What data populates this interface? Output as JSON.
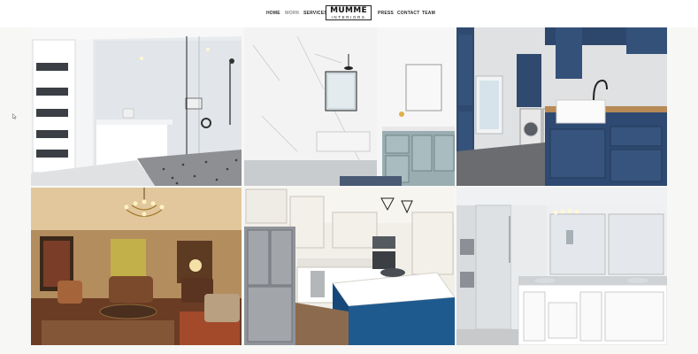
{
  "nav": {
    "items": [
      "HOME",
      "WORK",
      "SERVICES",
      "PRESS",
      "CONTACT",
      "TEAM"
    ],
    "active": "WORK"
  },
  "logo": {
    "line1": "MUMME",
    "line2": "INTERIORS"
  },
  "gallery": [
    {
      "name": "bathroom-shower-tub"
    },
    {
      "name": "bathroom-marble-shower"
    },
    {
      "name": "laundry-room-navy-cabinets"
    },
    {
      "name": "living-room-chandelier"
    },
    {
      "name": "kitchen-blue-island"
    },
    {
      "name": "bathroom-glass-shower-vanity"
    }
  ],
  "colors": {
    "accent": "#2e4a72",
    "nav_text": "#2b2b2b"
  }
}
